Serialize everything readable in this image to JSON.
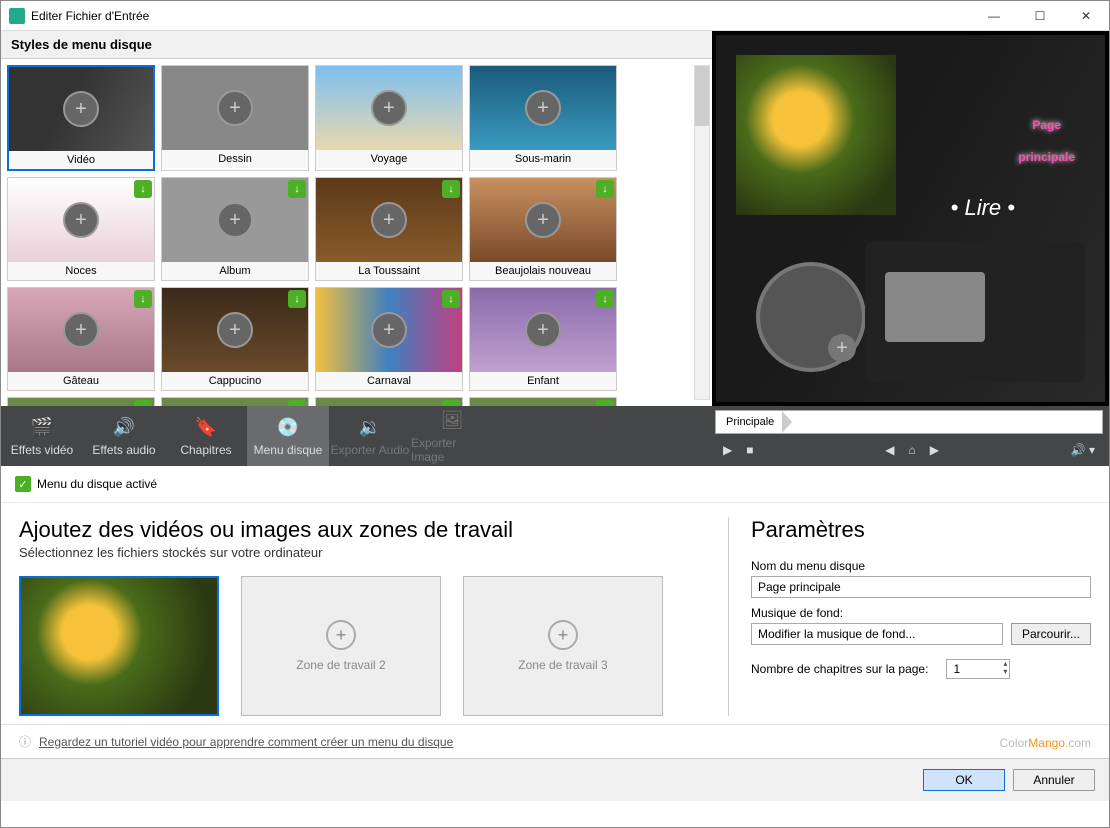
{
  "window": {
    "title": "Editer Fichier d'Entrée"
  },
  "styles_header": "Styles de menu disque",
  "style_cards": [
    {
      "label": "Vidéo",
      "cls": "th-video",
      "dl": false,
      "selected": true
    },
    {
      "label": "Dessin",
      "cls": "th-dessin",
      "dl": false
    },
    {
      "label": "Voyage",
      "cls": "th-voyage",
      "dl": false
    },
    {
      "label": "Sous-marin",
      "cls": "th-sousmarin",
      "dl": false
    },
    {
      "label": "Noces",
      "cls": "th-noces",
      "dl": true
    },
    {
      "label": "Album",
      "cls": "th-album",
      "dl": true
    },
    {
      "label": "La Toussaint",
      "cls": "th-toussaint",
      "dl": true
    },
    {
      "label": "Beaujolais nouveau",
      "cls": "th-beaujolais",
      "dl": true
    },
    {
      "label": "Gâteau",
      "cls": "th-gateau",
      "dl": true
    },
    {
      "label": "Cappucino",
      "cls": "th-cappucino",
      "dl": true
    },
    {
      "label": "Carnaval",
      "cls": "th-carnaval",
      "dl": true
    },
    {
      "label": "Enfant",
      "cls": "th-enfant",
      "dl": true
    }
  ],
  "preview": {
    "title_line1": "Page",
    "title_line2": "principale",
    "play_label": "• Lire •"
  },
  "toolbar": {
    "effets_video": "Effets vidéo",
    "effets_audio": "Effets audio",
    "chapitres": "Chapitres",
    "menu_disque": "Menu disque",
    "exporter_audio": "Exporter Audio",
    "exporter_image": "Exporter Image"
  },
  "breadcrumb": "Principale",
  "status": "Menu du disque activé",
  "work": {
    "heading": "Ajoutez des vidéos ou images aux zones de travail",
    "sub": "Sélectionnez les fichiers stockés sur votre ordinateur",
    "zone2": "Zone de travail 2",
    "zone3": "Zone de travail 3"
  },
  "params": {
    "heading": "Paramètres",
    "name_label": "Nom du menu disque",
    "name_value": "Page principale",
    "music_label": "Musique de fond:",
    "music_value": "Modifier la musique de fond...",
    "browse": "Parcourir...",
    "chapters_label": "Nombre de chapitres sur la page:",
    "chapters_value": "1"
  },
  "info_link": "Regardez un tutoriel vidéo pour apprendre comment créer un menu du disque",
  "buttons": {
    "ok": "OK",
    "cancel": "Annuler"
  },
  "watermark": {
    "a": "Color",
    "b": "Mango",
    "c": ".com"
  }
}
